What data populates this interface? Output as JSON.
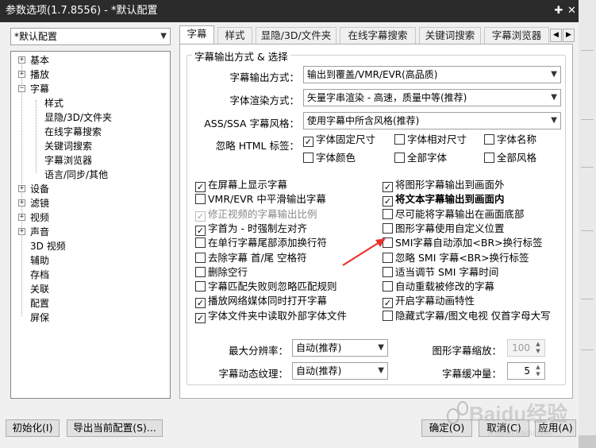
{
  "window": {
    "title": "参数选项(1.7.8556) - *默认配置",
    "pin_symbol": "✚",
    "close_symbol": "✕"
  },
  "profile_select": {
    "value": "*默认配置"
  },
  "tree": [
    {
      "label": "基本",
      "expander": "+"
    },
    {
      "label": "播放",
      "expander": "+"
    },
    {
      "label": "字幕",
      "expander": "−"
    },
    {
      "label": "样式"
    },
    {
      "label": "显隐/3D/文件夹"
    },
    {
      "label": "在线字幕搜索"
    },
    {
      "label": "关键词搜索"
    },
    {
      "label": "字幕浏览器"
    },
    {
      "label": "语言/同步/其他"
    },
    {
      "label": "设备",
      "expander": "+"
    },
    {
      "label": "滤镜",
      "expander": "+"
    },
    {
      "label": "视频",
      "expander": "+"
    },
    {
      "label": "声音",
      "expander": "+"
    },
    {
      "label": "3D 视频"
    },
    {
      "label": "辅助"
    },
    {
      "label": "存档"
    },
    {
      "label": "关联"
    },
    {
      "label": "配置"
    },
    {
      "label": "屏保"
    }
  ],
  "tabs": [
    "字幕",
    "样式",
    "显隐/3D/文件夹",
    "在线字幕搜索",
    "关键词搜索",
    "字幕浏览器"
  ],
  "tab_scroll": {
    "left": "◀",
    "right": "▶"
  },
  "group": {
    "title": "字幕输出方式 & 选择",
    "output_label": "字幕输出方式：",
    "output_value": "输出到覆盖/VMR/EVR(高品质)",
    "render_label": "字体渲染方式：",
    "render_value": "矢量字串渲染 - 高速，质量中等(推荐)",
    "style_label": "ASS/SSA 字幕风格：",
    "style_value": "使用字幕中所含风格(推荐)",
    "ignore_label": "忽略 HTML 标签：",
    "ignore_options": [
      {
        "label": "字体固定尺寸",
        "checked": true
      },
      {
        "label": "字体相对尺寸",
        "checked": false
      },
      {
        "label": "字体名称",
        "checked": false
      },
      {
        "label": "字体颜色",
        "checked": false
      },
      {
        "label": "全部字体",
        "checked": false
      },
      {
        "label": "全部风格",
        "checked": false
      }
    ],
    "left_options": [
      {
        "label": "在屏幕上显示字幕",
        "checked": true
      },
      {
        "label": "VMR/EVR 中平滑输出字幕",
        "checked": false
      },
      {
        "label": "修正视频的字幕输出比例",
        "checked": true,
        "disabled": true
      },
      {
        "label": "字首为 - 时强制左对齐",
        "checked": true
      },
      {
        "label": "在单行字幕尾部添加换行符",
        "checked": false
      },
      {
        "label": "去除字幕 首/尾 空格符",
        "checked": false
      },
      {
        "label": "删除空行",
        "checked": false
      },
      {
        "label": "字幕匹配失败则忽略匹配规则",
        "checked": false
      },
      {
        "label": "播放网络媒体同时打开字幕",
        "checked": true
      },
      {
        "label": "字体文件夹中读取外部字体文件",
        "checked": true
      }
    ],
    "right_options": [
      {
        "label": "将图形字幕输出到画面外",
        "checked": true
      },
      {
        "label": "将文本字幕输出到画面内",
        "checked": true,
        "bold": true
      },
      {
        "label": "尽可能将字幕输出在画面底部",
        "checked": false
      },
      {
        "label": "图形字幕使用自定义位置",
        "checked": false
      },
      {
        "label": "SMI字幕自动添加<BR>换行标签",
        "checked": false
      },
      {
        "label": "忽略 SMI 字幕<BR>换行标签",
        "checked": false
      },
      {
        "label": "适当调节 SMI 字幕时间",
        "checked": false
      },
      {
        "label": "自动重载被修改的字幕",
        "checked": false
      },
      {
        "label": "开启字幕动画特性",
        "checked": true
      },
      {
        "label": "隐藏式字幕/图文电视 仅首字母大写",
        "checked": false
      }
    ],
    "max_res_label": "最大分辨率：",
    "max_res_value": "自动(推荐)",
    "texture_label": "字幕动态纹理：",
    "texture_value": "自动(推荐)",
    "scale_label": "图形字幕缩放：",
    "scale_value": "100",
    "buffer_label": "字幕缓冲量：",
    "buffer_value": "5"
  },
  "buttons": {
    "init": "初始化(I)",
    "export": "导出当前配置(S)...",
    "ok": "确定(O)",
    "cancel": "取消(C)",
    "apply": "应用(A)"
  },
  "watermark": {
    "text": "Baidu经验",
    "sub": "jingyan.baidu.com"
  },
  "colors": {
    "arrow": "#e8322e",
    "title_bar": "#2b2b2b",
    "dialog": "#f0f0f0"
  }
}
